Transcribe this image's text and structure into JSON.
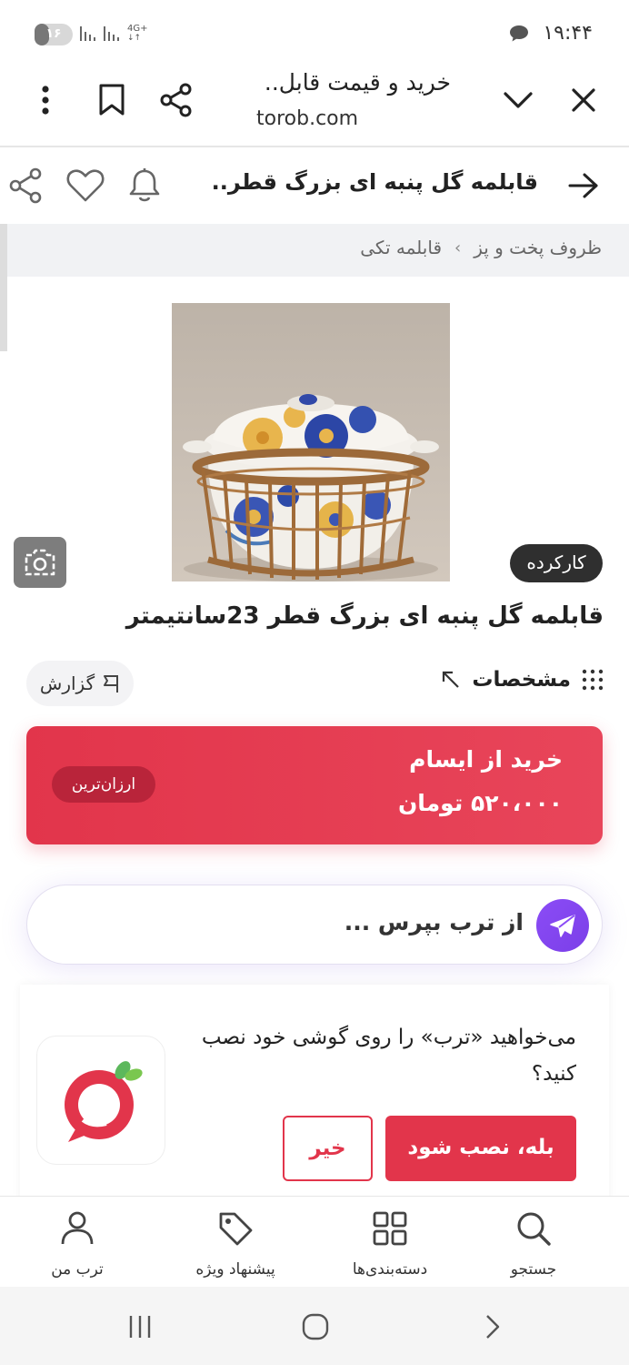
{
  "status_bar": {
    "time": "۱۹:۴۴",
    "battery": "۱۶",
    "network": "4G+"
  },
  "browser": {
    "title": "خرید و قیمت قابل..",
    "url": "torob.com"
  },
  "product_header": {
    "title": "قابلمه گل پنبه ای بزرگ قطر..."
  },
  "breadcrumb": {
    "items": [
      "ظروف پخت و پز",
      "قابلمه تکی"
    ],
    "separator": "›"
  },
  "product": {
    "badge": "کارکرده",
    "title": "قابلمه گل پنبه ای بزرگ قطر 23سانتیمتر"
  },
  "specs": {
    "label": "مشخصات",
    "report_label": "گزارش"
  },
  "buy": {
    "title": "خرید از ایسام",
    "price": "۵۲۰،۰۰۰ تومان",
    "badge": "ارزان‌ترین",
    "color": "#e2354b"
  },
  "ask": {
    "placeholder": "از ترب بپرس ..."
  },
  "install": {
    "text": "می‌خواهید «ترب» را روی گوشی خود نصب کنید؟",
    "yes_label": "بله، نصب شود",
    "no_label": "خیر"
  },
  "bottom_nav": {
    "items": [
      {
        "label": "جستجو",
        "icon": "search-icon"
      },
      {
        "label": "دسته‌بندی‌ها",
        "icon": "grid-icon"
      },
      {
        "label": "پیشنهاد ویژه",
        "icon": "tag-icon"
      },
      {
        "label": "ترب من",
        "icon": "user-icon"
      }
    ]
  }
}
